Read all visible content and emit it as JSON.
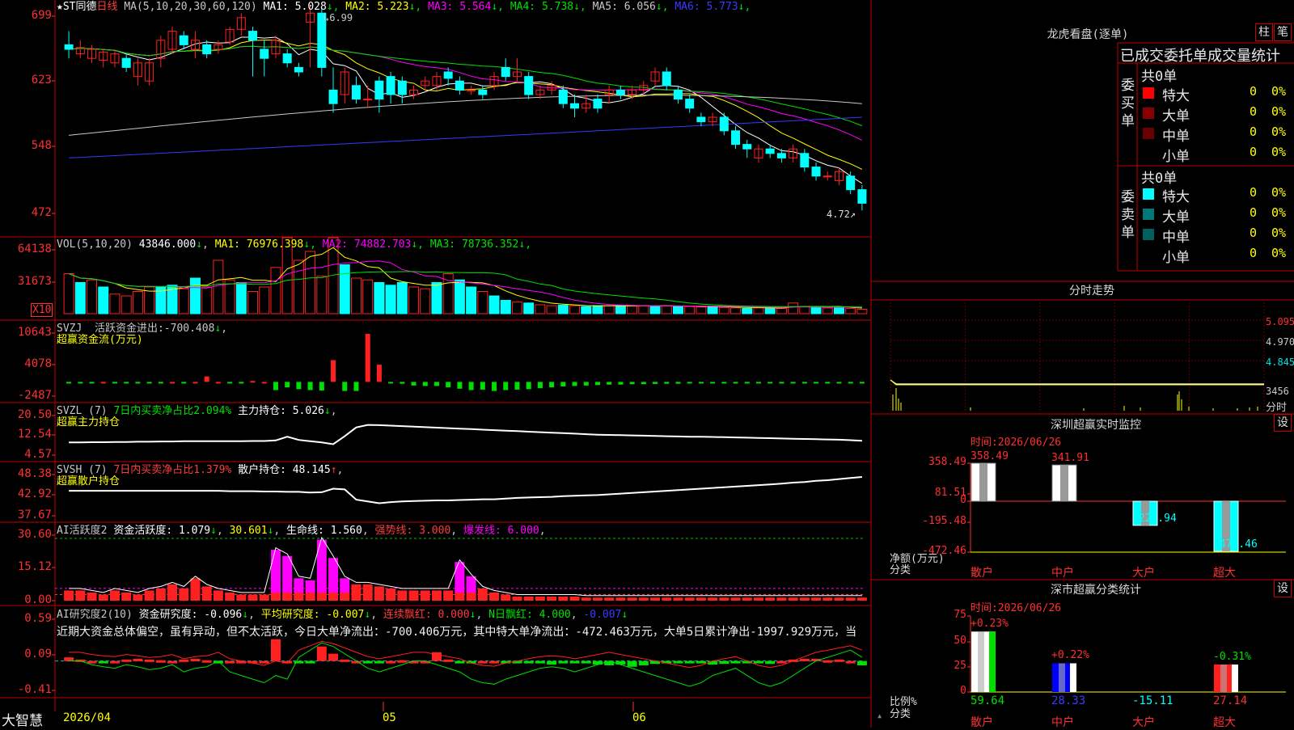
{
  "chart_data": [
    {
      "type": "candlestick",
      "title": "",
      "name": "★ST同德",
      "period": "日线",
      "ma_header": "MA(5,10,20,30,60,120)",
      "ma": [
        {
          "name": "MA1",
          "value": "5.028",
          "color": "#ffffff"
        },
        {
          "name": "MA2",
          "value": "5.223",
          "color": "#ffff00"
        },
        {
          "name": "MA3",
          "value": "5.564",
          "color": "#ff00ff"
        },
        {
          "name": "MA4",
          "value": "5.738",
          "color": "#00e000"
        },
        {
          "name": "MA5",
          "value": "6.056",
          "color": "#c8c8c8"
        },
        {
          "name": "MA6",
          "value": "5.773",
          "color": "#3a3aff"
        }
      ],
      "yticks": [
        "699",
        "623",
        "548",
        "472"
      ],
      "ylim": [
        4.5,
        7.0
      ],
      "high_label": "6.99",
      "low_label": "4.72",
      "candles": [
        [
          6.55,
          6.5,
          6.7,
          6.4
        ],
        [
          6.45,
          6.52,
          6.6,
          6.4
        ],
        [
          6.4,
          6.5,
          6.55,
          6.35
        ],
        [
          6.38,
          6.47,
          6.5,
          6.3
        ],
        [
          6.35,
          6.45,
          6.5,
          6.3
        ],
        [
          6.4,
          6.3,
          6.45,
          6.25
        ],
        [
          6.2,
          6.35,
          6.4,
          6.1
        ],
        [
          6.15,
          6.35,
          6.4,
          6.1
        ],
        [
          6.4,
          6.6,
          6.65,
          6.3
        ],
        [
          6.5,
          6.7,
          6.75,
          6.45
        ],
        [
          6.65,
          6.55,
          6.7,
          6.5
        ],
        [
          6.5,
          6.6,
          6.7,
          6.4
        ],
        [
          6.55,
          6.45,
          6.6,
          6.4
        ],
        [
          6.5,
          6.55,
          6.6,
          6.45
        ],
        [
          6.58,
          6.72,
          6.75,
          6.55
        ],
        [
          6.72,
          6.85,
          6.9,
          6.65
        ],
        [
          6.7,
          6.6,
          6.75,
          6.2
        ],
        [
          6.5,
          6.4,
          6.6,
          6.2
        ],
        [
          6.45,
          6.6,
          6.65,
          6.4
        ],
        [
          6.45,
          6.35,
          6.5,
          6.3
        ],
        [
          6.3,
          6.25,
          6.35,
          6.2
        ],
        [
          6.8,
          6.9,
          6.99,
          6.3
        ],
        [
          6.9,
          6.3,
          6.95,
          6.2
        ],
        [
          6.05,
          5.9,
          6.3,
          5.8
        ],
        [
          6.0,
          6.25,
          6.3,
          5.9
        ],
        [
          6.1,
          5.95,
          6.2,
          5.9
        ],
        [
          5.95,
          5.95,
          6.1,
          5.85
        ],
        [
          6.15,
          5.95,
          6.2,
          5.8
        ],
        [
          6.2,
          6.0,
          6.25,
          5.9
        ],
        [
          6.15,
          6.0,
          6.2,
          5.9
        ],
        [
          6.0,
          6.05,
          6.1,
          5.95
        ],
        [
          6.1,
          6.15,
          6.2,
          6.05
        ],
        [
          6.1,
          6.2,
          6.25,
          6.05
        ],
        [
          6.25,
          6.18,
          6.3,
          6.1
        ],
        [
          6.15,
          6.05,
          6.2,
          6.0
        ],
        [
          6.05,
          6.05,
          6.1,
          6.0
        ],
        [
          6.05,
          6.0,
          6.1,
          5.95
        ],
        [
          6.1,
          6.2,
          6.25,
          6.05
        ],
        [
          6.3,
          6.2,
          6.4,
          6.15
        ],
        [
          6.2,
          6.25,
          6.4,
          6.15
        ],
        [
          6.2,
          6.0,
          6.25,
          5.95
        ],
        [
          6.0,
          6.05,
          6.1,
          5.95
        ],
        [
          6.05,
          6.1,
          6.15,
          6.0
        ],
        [
          6.05,
          5.9,
          6.1,
          5.85
        ],
        [
          5.9,
          5.85,
          6.0,
          5.75
        ],
        [
          5.85,
          5.9,
          6.0,
          5.8
        ],
        [
          5.95,
          5.85,
          6.0,
          5.8
        ],
        [
          6.0,
          6.05,
          6.1,
          5.9
        ],
        [
          6.05,
          6.0,
          6.1,
          5.95
        ],
        [
          6.0,
          6.05,
          6.1,
          5.95
        ],
        [
          6.05,
          6.1,
          6.15,
          6.0
        ],
        [
          6.15,
          6.25,
          6.3,
          6.1
        ],
        [
          6.25,
          6.1,
          6.3,
          6.05
        ],
        [
          6.05,
          5.95,
          6.1,
          5.9
        ],
        [
          5.95,
          5.85,
          6.0,
          5.8
        ],
        [
          5.75,
          5.7,
          5.8,
          5.65
        ],
        [
          5.7,
          5.75,
          5.8,
          5.65
        ],
        [
          5.75,
          5.6,
          5.8,
          5.55
        ],
        [
          5.6,
          5.45,
          5.65,
          5.4
        ],
        [
          5.45,
          5.4,
          5.5,
          5.3
        ],
        [
          5.3,
          5.4,
          5.45,
          5.25
        ],
        [
          5.4,
          5.35,
          5.45,
          5.3
        ],
        [
          5.35,
          5.3,
          5.4,
          5.25
        ],
        [
          5.3,
          5.4,
          5.45,
          5.25
        ],
        [
          5.35,
          5.2,
          5.4,
          5.15
        ],
        [
          5.2,
          5.1,
          5.25,
          5.05
        ],
        [
          5.1,
          5.1,
          5.15,
          5.05
        ],
        [
          5.05,
          5.15,
          5.2,
          5.0
        ],
        [
          5.1,
          4.95,
          5.15,
          4.9
        ],
        [
          4.95,
          4.8,
          5.0,
          4.72
        ]
      ]
    },
    {
      "type": "bar",
      "title": "",
      "header": "VOL(5,10,20)",
      "value": "43846.000",
      "ma": [
        {
          "name": "MA1",
          "value": "76976.398",
          "color": "#ffff00"
        },
        {
          "name": "MA2",
          "value": "74882.703",
          "color": "#ff00ff"
        },
        {
          "name": "MA3",
          "value": "78736.352",
          "color": "#00e000"
        }
      ],
      "yticks": [
        "64138",
        "31673"
      ],
      "unit": "X10",
      "ylim": [
        0,
        80000
      ],
      "values": [
        45000,
        35000,
        38000,
        30000,
        22000,
        20000,
        25000,
        30000,
        30000,
        32000,
        28000,
        40000,
        30000,
        60000,
        38000,
        35000,
        25000,
        30000,
        52000,
        110000,
        60000,
        70000,
        42000,
        90000,
        55000,
        40000,
        38000,
        35000,
        32000,
        35000,
        30000,
        28000,
        35000,
        45000,
        38000,
        30000,
        25000,
        20000,
        15000,
        13000,
        12000,
        10000,
        9000,
        9500,
        9000,
        8000,
        9000,
        9000,
        9000,
        8500,
        9000,
        8500,
        9000,
        8500,
        8000,
        7500,
        8000,
        7000,
        6500,
        6000,
        6500,
        7000,
        6000,
        12000,
        8000,
        7500,
        6500,
        7000,
        6000,
        5000
      ],
      "up": [
        1,
        0,
        1,
        0,
        1,
        1,
        1,
        1,
        0,
        0,
        1,
        0,
        1,
        1,
        1,
        0,
        1,
        1,
        1,
        1,
        1,
        1,
        1,
        1,
        0,
        1,
        1,
        0,
        0,
        0,
        1,
        1,
        0,
        1,
        0,
        0,
        1,
        0,
        0,
        1,
        0,
        1,
        1,
        0,
        1,
        0,
        0,
        1,
        0,
        1,
        1,
        0,
        1,
        0,
        1,
        1,
        0,
        1,
        1,
        0,
        1,
        0,
        1,
        1,
        1,
        0,
        1,
        0,
        1,
        1
      ]
    },
    {
      "type": "bar",
      "title": "",
      "header": "SVZJ",
      "label1": "活跃资金进出:",
      "value1": "-700.408",
      "subtitle": "超赢资金流(万元)",
      "yticks": [
        "10643",
        "4078",
        "-2487"
      ],
      "ylim": [
        -3500,
        11500
      ],
      "values": [
        -200,
        -150,
        -120,
        0,
        -180,
        -200,
        -150,
        -100,
        -200,
        0,
        -180,
        0,
        1200,
        0,
        -200,
        -300,
        200,
        0,
        -1800,
        -1200,
        -1600,
        -1800,
        -1900,
        4800,
        -2000,
        -2000,
        10600,
        3800,
        -300,
        -400,
        -800,
        -900,
        -900,
        -1200,
        -1500,
        -1800,
        -1700,
        -2000,
        -1800,
        -1700,
        -1600,
        -1400,
        -1200,
        -1000,
        -900,
        -800,
        -700,
        -600,
        -600,
        -500,
        -500,
        -450,
        -400,
        -400,
        -350,
        -300,
        -300,
        -250,
        -250,
        -200,
        -200,
        -180,
        -160,
        -150,
        -140,
        -130,
        -120,
        -110,
        -100,
        -90
      ]
    },
    {
      "type": "line",
      "title": "",
      "header": "SVZL (7)",
      "label1": "7日内买卖净占比2.094%",
      "label2": "主力持仓:",
      "value2": "5.026",
      "subtitle": "超赢主力持仓",
      "yticks": [
        "20.50",
        "12.54",
        "4.57"
      ],
      "ylim": [
        3.5,
        21.5
      ],
      "values": [
        9.5,
        9.5,
        9.6,
        9.6,
        9.7,
        9.7,
        9.8,
        9.8,
        9.9,
        9.9,
        10.0,
        10.0,
        10.0,
        10.0,
        10.0,
        10.0,
        10.1,
        10.1,
        10.3,
        11.8,
        10.5,
        10.0,
        9.5,
        8.8,
        12.0,
        15.5,
        16.5,
        16.4,
        16.2,
        16.0,
        15.8,
        15.6,
        15.4,
        15.2,
        15.0,
        14.8,
        14.6,
        14.4,
        14.2,
        14.0,
        13.8,
        13.6,
        13.4,
        13.2,
        13.0,
        12.8,
        12.6,
        12.5,
        12.4,
        12.3,
        12.2,
        12.1,
        12.0,
        11.9,
        11.8,
        11.8,
        11.7,
        11.6,
        11.5,
        11.4,
        11.3,
        11.2,
        11.1,
        11.0,
        10.9,
        10.8,
        10.7,
        10.6,
        10.4,
        10.2
      ]
    },
    {
      "type": "line",
      "title": "",
      "header": "SVSH (7)",
      "label1": "7日内买卖净占比1.379%",
      "label2": "散户持仓:",
      "value2": "48.145",
      "subtitle": "超赢散户持仓",
      "yticks": [
        "48.38",
        "42.92",
        "37.67"
      ],
      "ylim": [
        36.5,
        49.5
      ],
      "values": [
        44.0,
        44.0,
        44.0,
        44.0,
        44.0,
        44.0,
        44.0,
        44.0,
        44.0,
        44.0,
        44.0,
        44.0,
        44.0,
        44.0,
        43.9,
        43.9,
        43.9,
        43.8,
        43.8,
        43.7,
        43.7,
        43.5,
        43.6,
        44.6,
        44.4,
        41.5,
        41.0,
        40.5,
        40.8,
        41.0,
        41.1,
        41.2,
        41.3,
        41.3,
        41.4,
        41.5,
        41.6,
        41.6,
        41.8,
        42.0,
        42.1,
        42.2,
        42.3,
        42.5,
        42.6,
        42.7,
        42.8,
        43.0,
        43.2,
        43.4,
        43.6,
        43.8,
        44.0,
        44.2,
        44.4,
        44.6,
        44.8,
        45.0,
        45.2,
        45.4,
        45.6,
        45.8,
        46.0,
        46.3,
        46.5,
        46.8,
        47.0,
        47.3,
        47.6,
        47.9
      ]
    },
    {
      "type": "bar",
      "title": "",
      "header": "AI活跃度2",
      "label1": "资金活跃度:",
      "value1": "1.079",
      "value2": "30.601",
      "label3": "生命线:",
      "value3": "1.560",
      "label4": "强势线:",
      "value4": "3.000",
      "label5": "爆发线:",
      "value5": "6.000",
      "yticks": [
        "30.60",
        "15.12",
        "0.00"
      ],
      "ylim": [
        0,
        33
      ],
      "values": [
        5,
        5,
        4,
        3,
        5,
        4,
        3,
        5,
        6,
        8,
        6,
        11,
        7,
        5,
        4,
        3,
        3,
        3,
        25,
        22,
        11,
        10,
        30,
        21,
        11,
        8,
        8,
        7,
        6,
        5,
        5,
        5,
        5,
        5,
        19,
        12,
        6,
        4,
        3,
        2,
        2,
        2,
        2,
        2,
        2,
        1.5,
        1.5,
        1.5,
        1.5,
        1.5,
        1.5,
        1.5,
        1.5,
        1.5,
        1.5,
        1.5,
        1.5,
        1.5,
        1.5,
        1.5,
        1.5,
        1.5,
        1.5,
        1.5,
        1.5,
        1.5,
        1.5,
        1.5,
        1.5,
        1.5
      ],
      "magenta": [
        0,
        0,
        0,
        0,
        0,
        0,
        0,
        0,
        0,
        0,
        0,
        0,
        0,
        0,
        0,
        0,
        0,
        0,
        1,
        1,
        1,
        1,
        1,
        1,
        1,
        0,
        0,
        0,
        0,
        0,
        0,
        0,
        0,
        0,
        1,
        1,
        0,
        0,
        0,
        0,
        0,
        0,
        0,
        0,
        0,
        0,
        0,
        0,
        0,
        0,
        0,
        0,
        0,
        0,
        0,
        0,
        0,
        0,
        0,
        0,
        0,
        0,
        0,
        0,
        0,
        0,
        0,
        0,
        0,
        0
      ]
    },
    {
      "type": "bar",
      "title": "",
      "header": "AI研究度2(10)",
      "label1": "资金研究度:",
      "value1": "-0.096",
      "label2": "平均研究度:",
      "value2": "-0.007",
      "label3": "连续飘红:",
      "value3": "0.000",
      "label4": "N日飘红:",
      "value4": "4.000",
      "value5": "-0.007",
      "commentary": "近期大资金总体偏空，虽有异动，但不太活跃，今日大单净流出：-700.406万元，其中特大单净流出：-472.463万元，大单5日累计净出-1997.929万元，当",
      "yticks": [
        "0.59",
        "0.09",
        "-0.41"
      ],
      "ylim": [
        -0.45,
        0.62
      ],
      "values": [
        0.05,
        0.02,
        0.0,
        -0.02,
        0.0,
        0.02,
        0.03,
        0.02,
        0.01,
        0.0,
        0.02,
        0.03,
        0.01,
        -0.02,
        0.0,
        0.0,
        0.0,
        0.0,
        0.3,
        0.0,
        -0.02,
        -0.03,
        0.2,
        0.1,
        0.02,
        0.0,
        -0.02,
        -0.03,
        0.0,
        0.01,
        0.0,
        0.0,
        0.12,
        0.02,
        -0.02,
        -0.03,
        0.0,
        0.0,
        -0.02,
        -0.03,
        -0.02,
        -0.03,
        -0.05,
        -0.03,
        -0.02,
        -0.03,
        -0.05,
        -0.06,
        -0.05,
        -0.08,
        -0.06,
        -0.04,
        -0.03,
        -0.02,
        -0.03,
        -0.02,
        -0.05,
        -0.04,
        -0.03,
        -0.02,
        -0.03,
        -0.04,
        0.0,
        0.02,
        0.03,
        0.03,
        0.01,
        0.02,
        0.0,
        -0.06
      ],
      "line": [
        0.0,
        0.0,
        -0.05,
        -0.08,
        -0.1,
        -0.05,
        -0.08,
        -0.12,
        -0.1,
        -0.05,
        -0.15,
        -0.1,
        -0.08,
        0.0,
        -0.15,
        -0.2,
        -0.25,
        -0.3,
        -0.2,
        -0.25,
        0.05,
        0.15,
        0.25,
        0.2,
        0.1,
        0.0,
        -0.1,
        -0.15,
        -0.1,
        -0.05,
        0.0,
        0.0,
        -0.05,
        -0.1,
        -0.15,
        -0.25,
        -0.3,
        -0.32,
        -0.25,
        -0.2,
        -0.15,
        -0.1,
        -0.08,
        -0.1,
        -0.15,
        -0.1,
        -0.05,
        0.0,
        -0.05,
        -0.1,
        -0.15,
        -0.2,
        -0.25,
        -0.3,
        -0.35,
        -0.3,
        -0.2,
        -0.15,
        -0.1,
        -0.2,
        -0.3,
        -0.35,
        -0.3,
        -0.2,
        -0.1,
        0.0,
        0.05,
        0.1,
        0.15,
        0.05
      ]
    },
    {
      "type": "bar",
      "title": "深圳超赢实时监控",
      "time_label": "时间:",
      "time": "2026/06/26",
      "categories": [
        "散户",
        "中户",
        "大户",
        "超大"
      ],
      "values": [
        358.49,
        341.91,
        -227.94,
        -472.46
      ],
      "value_labels": [
        "358.49",
        "341.91",
        "-227.94",
        "-472.46"
      ],
      "yticks": [
        "358.49",
        "81.51",
        "0",
        "-195.48",
        "-472.46"
      ],
      "ylabel": "净额(万元)",
      "xlabel": "分类"
    },
    {
      "type": "bar",
      "title": "深市超赢分类统计",
      "time_label": "时间:",
      "time": "2026/06/26",
      "categories": [
        "散户",
        "中户",
        "大户",
        "超大"
      ],
      "values": [
        59.64,
        28.33,
        -15.11,
        27.14
      ],
      "top_labels": [
        "+0.23%",
        "+0.22%",
        "",
        "-0.31%"
      ],
      "bottom_labels": [
        "59.64",
        "28.33",
        "-15.11",
        "27.14"
      ],
      "yticks": [
        "75",
        "50",
        "25",
        "0"
      ],
      "ylabel": "比例%",
      "xlabel": "分类"
    },
    {
      "type": "line",
      "title": "分时走势",
      "yticks": [
        "5.095",
        "4.970",
        "4.845",
        "3456"
      ],
      "bottom_label": "分时"
    }
  ],
  "x_dates": [
    "2026/04",
    "05",
    "06"
  ],
  "app_name": "大智慧",
  "longhu": {
    "title": "龙虎看盘(逐单)",
    "btn1": "柱",
    "btn2": "笔",
    "header": "已成交委托单成交量统计",
    "buy_label": "委买单",
    "sell_label": "委卖单",
    "buy_count": "共0单",
    "sell_count": "共0单",
    "rows": [
      {
        "name": "特大",
        "qty": "0",
        "pct": "0%"
      },
      {
        "name": "大单",
        "qty": "0",
        "pct": "0%"
      },
      {
        "name": "中单",
        "qty": "0",
        "pct": "0%"
      },
      {
        "name": "小单",
        "qty": "0",
        "pct": "0%"
      }
    ]
  },
  "set_btn": "设",
  "colors": {
    "up": "#ff2020",
    "down": "#00ffff",
    "border": "#c00000"
  }
}
